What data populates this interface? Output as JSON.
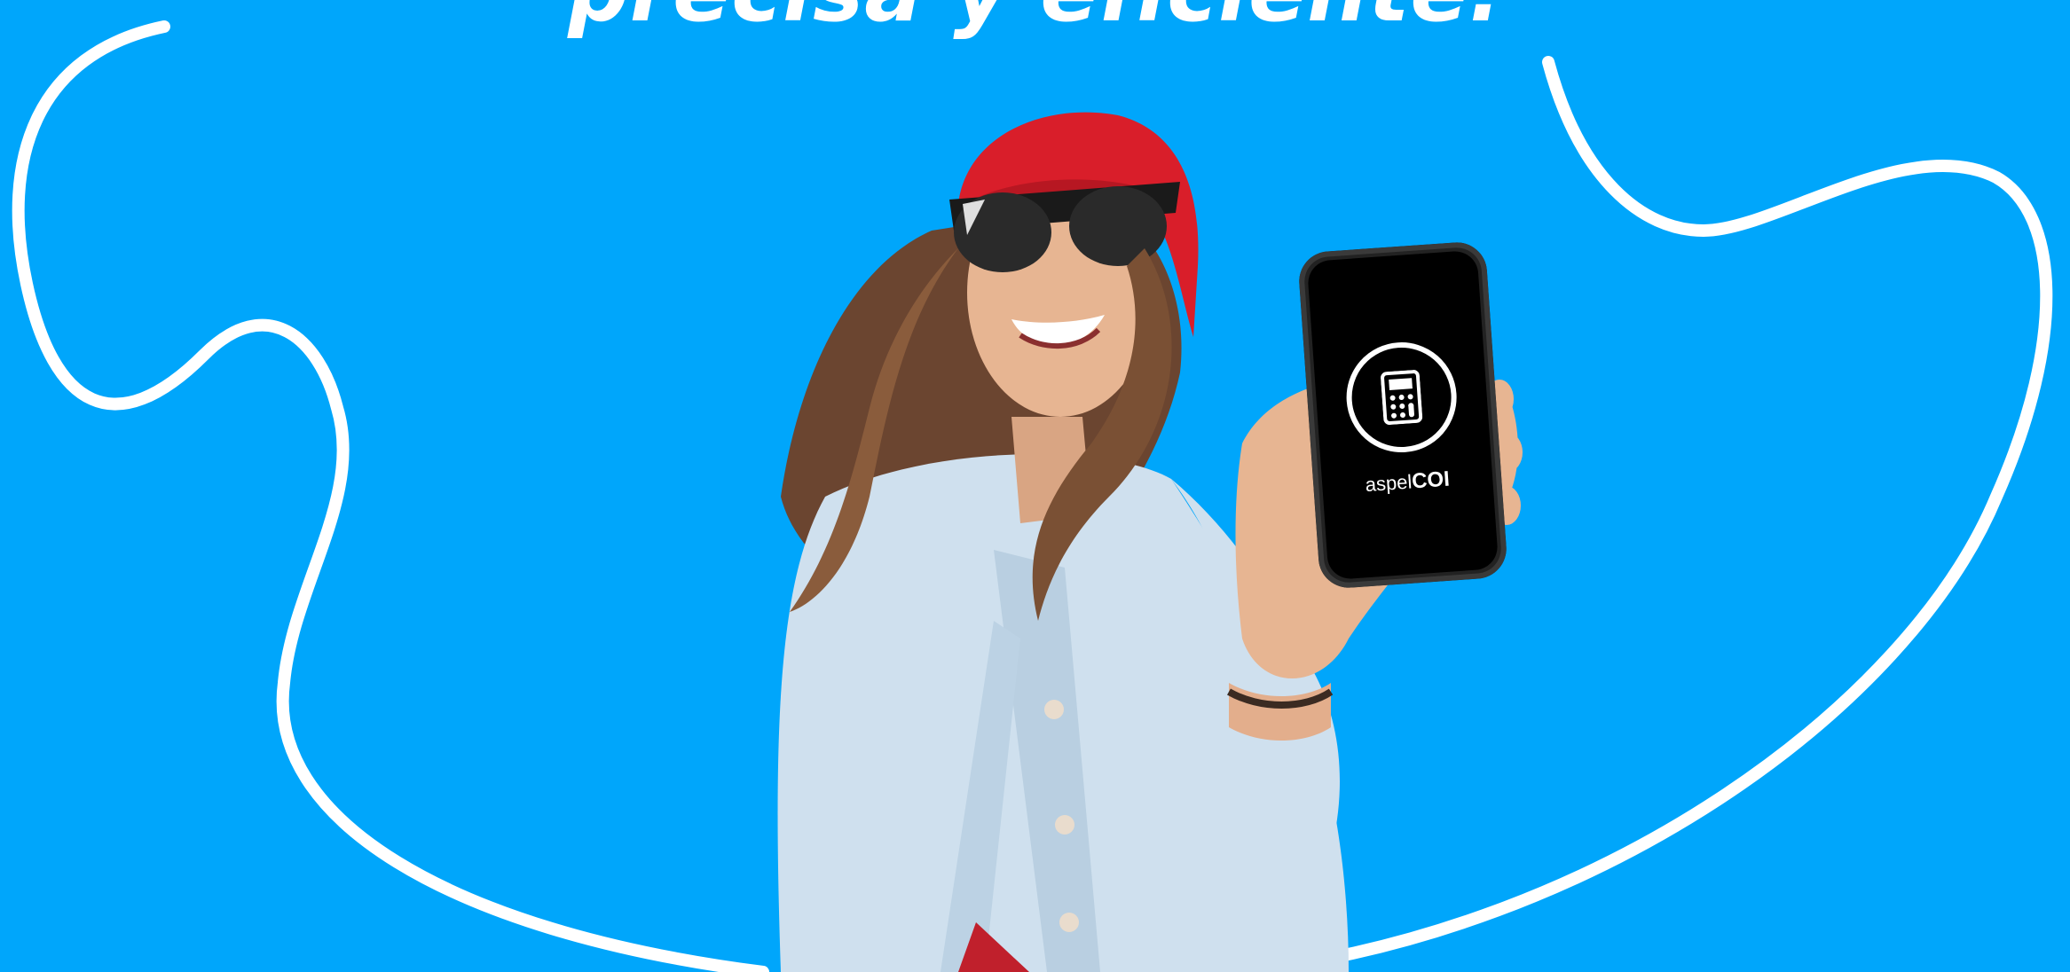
{
  "headline": {
    "text": "precisa y eficiente."
  },
  "phone": {
    "app_icon": "calculator-icon",
    "brand_prefix": "aspel",
    "brand_name": "COI"
  },
  "colors": {
    "background": "#00a6fb",
    "accent_line": "#ffffff",
    "phone_body": "#222222",
    "phone_screen": "#000000",
    "beanie": "#d91e2a",
    "jacket": "#cfe0ee",
    "hair": "#7a5034",
    "skin": "#e7b592"
  }
}
